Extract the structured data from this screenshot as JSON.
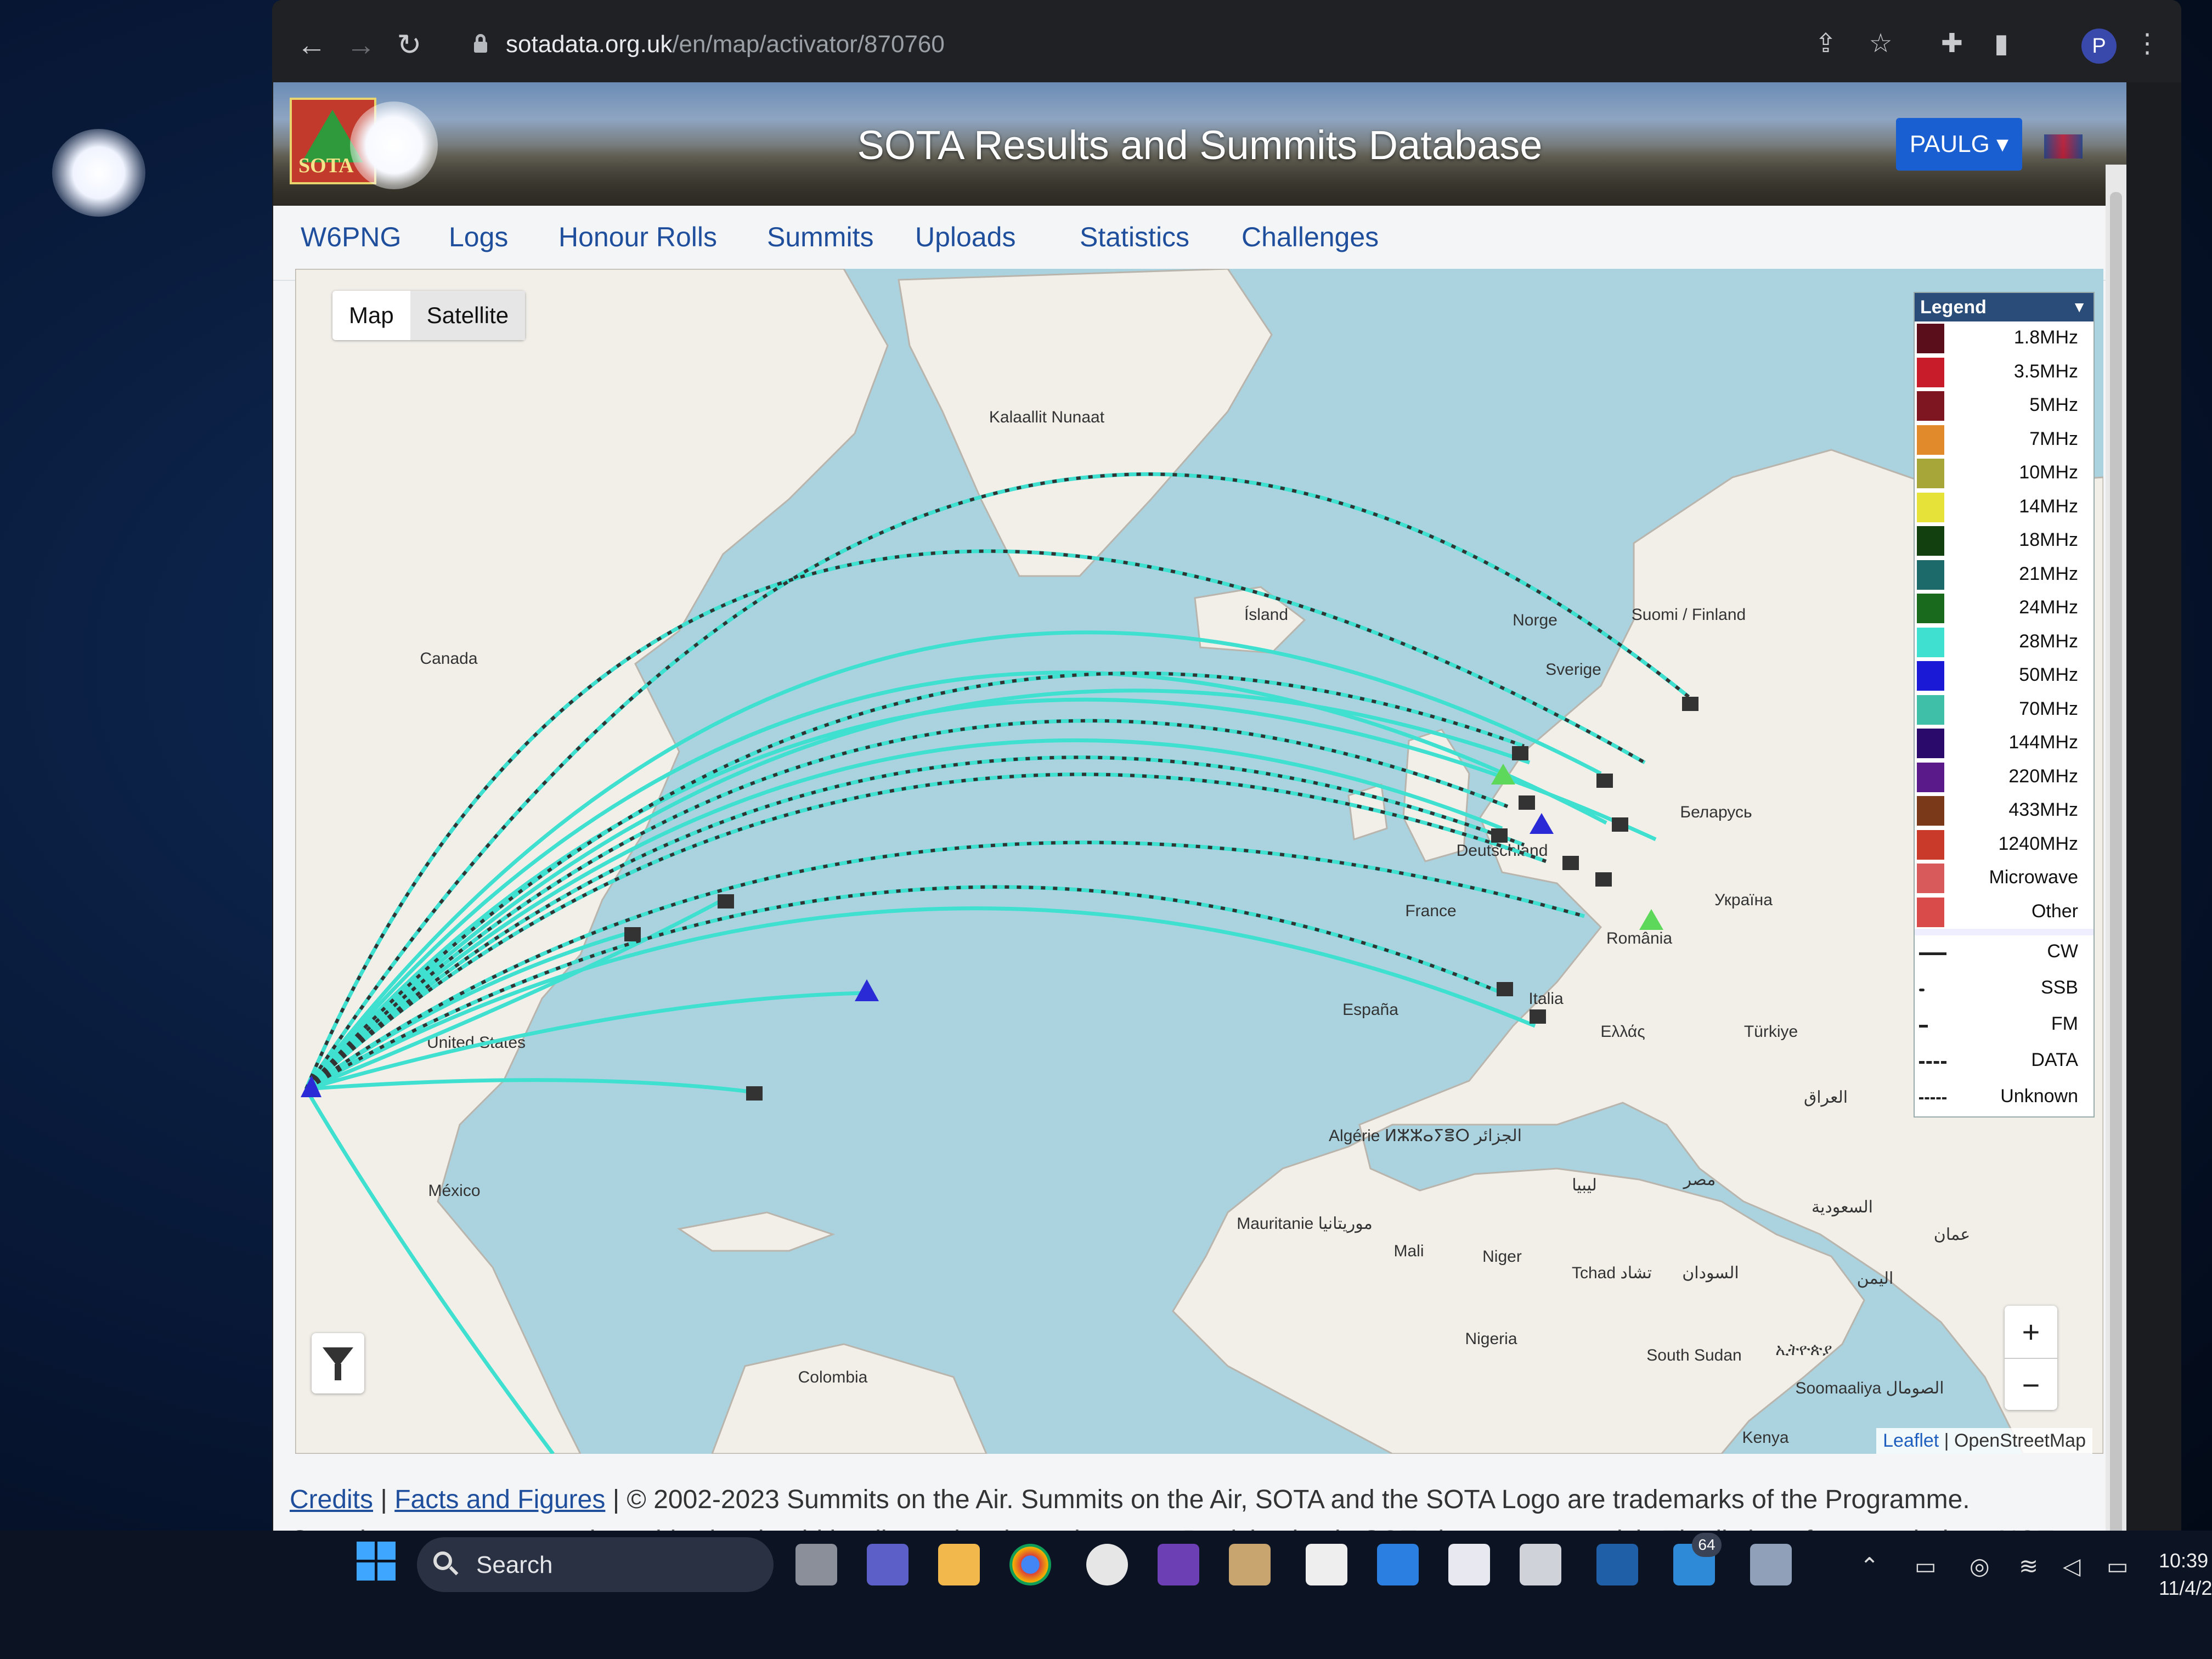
{
  "browser": {
    "url_host": "sotadata.org.uk",
    "url_path": "/en/map/activator/870760",
    "profile_initial": "P"
  },
  "site": {
    "title": "SOTA Results and Summits Database",
    "logo_text": "SOTA",
    "user_button": "PAULG"
  },
  "nav": [
    "W6PNG",
    "Logs",
    "Honour Rolls",
    "Summits",
    "Uploads",
    "Statistics",
    "Challenges"
  ],
  "map": {
    "toggle": [
      "Map",
      "Satellite"
    ],
    "legend_title": "Legend",
    "bands": [
      {
        "label": "1.8MHz",
        "color": "#5a0d1a"
      },
      {
        "label": "3.5MHz",
        "color": "#c91c2a"
      },
      {
        "label": "5MHz",
        "color": "#7d1620"
      },
      {
        "label": "7MHz",
        "color": "#e08a2c"
      },
      {
        "label": "10MHz",
        "color": "#a7a638"
      },
      {
        "label": "14MHz",
        "color": "#e6e23a"
      },
      {
        "label": "18MHz",
        "color": "#12400f"
      },
      {
        "label": "21MHz",
        "color": "#1d6a6a"
      },
      {
        "label": "24MHz",
        "color": "#1a6a1e"
      },
      {
        "label": "28MHz",
        "color": "#3fe0d0"
      },
      {
        "label": "50MHz",
        "color": "#1a1ad6"
      },
      {
        "label": "70MHz",
        "color": "#3fbfa8"
      },
      {
        "label": "144MHz",
        "color": "#2a0a6a"
      },
      {
        "label": "220MHz",
        "color": "#5a1a8a"
      },
      {
        "label": "433MHz",
        "color": "#7a3a1a"
      },
      {
        "label": "1240MHz",
        "color": "#c93a2a"
      },
      {
        "label": "Microwave",
        "color": "#d95a5a"
      },
      {
        "label": "Other",
        "color": "#d94a4a"
      }
    ],
    "modes": [
      "CW",
      "SSB",
      "FM",
      "DATA",
      "Unknown"
    ],
    "place_labels": [
      "Kalaallit Nunaat",
      "Canada",
      "Ísland",
      "Norge",
      "Sverige",
      "Suomi / Finland",
      "Беларусь",
      "Україна",
      "Deutschland",
      "France",
      "România",
      "Italia",
      "España",
      "Ελλάς",
      "Türkiye",
      "United States",
      "México",
      "Algérie ⵍⵣⵣⴰⵢⴻⵔ الجزائر",
      "ليبيا",
      "مصر",
      "العراق",
      "السعودية",
      "عمان",
      "اليمن",
      "Mauritanie موريتانيا",
      "Mali",
      "Niger",
      "Tchad تشاد",
      "السودان",
      "Nigeria",
      "South Sudan",
      "ኢትዮጵያ",
      "Soomaaliya الصومال",
      "Colombia",
      "Kenya"
    ],
    "attribution_leaflet": "Leaflet",
    "attribution_osm": "OpenStreetMap",
    "zoom_in": "+",
    "zoom_out": "−"
  },
  "footer": {
    "credits": "Credits",
    "facts": "Facts and Figures",
    "copyright": "| © 2002-2023 Summits on the Air. Summits on the Air, SOTA and the SOTA Logo are trademarks of the Programme.",
    "line2": "Questions or comments about this site should be directed to the webmaster. Participation in SOTA is at your own risk. The listing of a summit does NOT"
  },
  "taskbar": {
    "search": "Search",
    "mail_badge": "64",
    "clock_time": "10:39",
    "clock_date": "11/4/2"
  }
}
